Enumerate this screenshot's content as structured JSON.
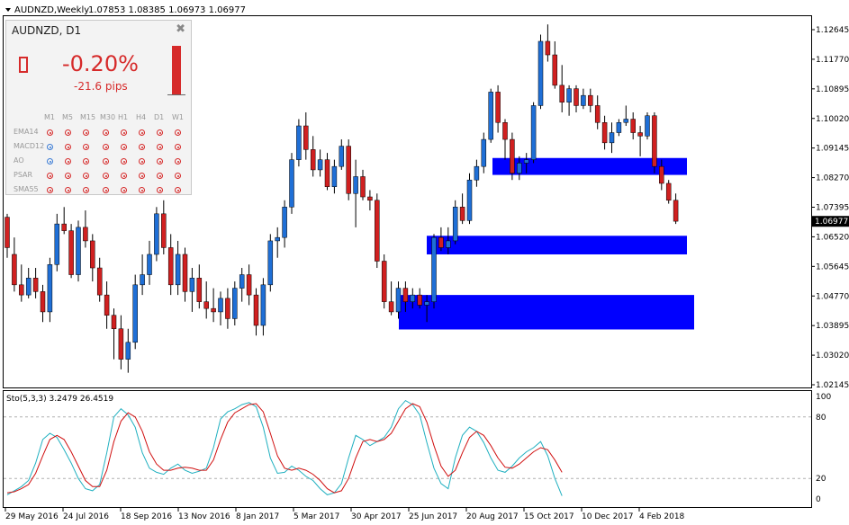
{
  "header": {
    "symbol_tf": "AUDNZD,Weekly",
    "ohlc": "1.07853 1.08385 1.06973 1.06977"
  },
  "panel": {
    "title": "AUDNZD,  D1",
    "change_pct": "-0.20%",
    "change_pips": "-21.6 pips",
    "close_icon": "close-icon",
    "timeframes": [
      "M1",
      "M5",
      "M15",
      "M30",
      "H1",
      "H4",
      "D1",
      "W1"
    ],
    "indicators": [
      {
        "name": "EMA14",
        "signals": [
          "sell",
          "sell",
          "sell",
          "sell",
          "sell",
          "sell",
          "sell",
          "sell"
        ]
      },
      {
        "name": "MACD12",
        "signals": [
          "buy",
          "sell",
          "sell",
          "sell",
          "sell",
          "sell",
          "sell",
          "sell"
        ]
      },
      {
        "name": "AO",
        "signals": [
          "buy",
          "sell",
          "sell",
          "sell",
          "sell",
          "sell",
          "sell",
          "sell"
        ]
      },
      {
        "name": "PSAR",
        "signals": [
          "sell",
          "sell",
          "sell",
          "sell",
          "sell",
          "sell",
          "sell",
          "sell"
        ]
      },
      {
        "name": "SMA55",
        "signals": [
          "sell",
          "sell",
          "sell",
          "sell",
          "sell",
          "sell",
          "sell",
          "sell"
        ]
      }
    ]
  },
  "price_axis": {
    "ticks": [
      "1.12645",
      "1.11770",
      "1.10895",
      "1.10020",
      "1.09145",
      "1.08270",
      "1.07395",
      "1.06520",
      "1.05645",
      "1.04770",
      "1.03895",
      "1.03020",
      "1.02145"
    ],
    "current": "1.06977"
  },
  "oscillator": {
    "label": "Sto(5,3,3) 3.2479 26.4519",
    "levels": [
      "100",
      "80",
      "20",
      "0"
    ]
  },
  "time_axis": [
    "29 May 2016",
    "24 Jul 2016",
    "18 Sep 2016",
    "13 Nov 2016",
    "8 Jan 2017",
    "5 Mar 2017",
    "30 Apr 2017",
    "25 Jun 2017",
    "20 Aug 2017",
    "15 Oct 2017",
    "10 Dec 2017",
    "4 Feb 2018"
  ],
  "colors": {
    "bull": "#1f6fd6",
    "bear": "#d02020",
    "zone": "#0000ff",
    "stoch_main": "#20b0c0",
    "stoch_signal": "#d01010"
  },
  "chart_data": {
    "type": "candlestick",
    "price_range": [
      1.02,
      1.13
    ],
    "zones": [
      {
        "from": 1.0835,
        "to": 1.0885
      },
      {
        "from": 1.06,
        "to": 1.0655
      },
      {
        "from": 1.0378,
        "to": 1.048
      }
    ],
    "candles": [
      [
        1.071,
        1.072,
        1.059,
        1.062
      ],
      [
        1.06,
        1.065,
        1.049,
        1.051
      ],
      [
        1.051,
        1.057,
        1.046,
        1.048
      ],
      [
        1.048,
        1.056,
        1.047,
        1.053
      ],
      [
        1.053,
        1.056,
        1.047,
        1.049
      ],
      [
        1.049,
        1.051,
        1.04,
        1.043
      ],
      [
        1.043,
        1.059,
        1.04,
        1.057
      ],
      [
        1.057,
        1.072,
        1.055,
        1.069
      ],
      [
        1.069,
        1.074,
        1.066,
        1.067
      ],
      [
        1.067,
        1.069,
        1.053,
        1.054
      ],
      [
        1.054,
        1.07,
        1.052,
        1.068
      ],
      [
        1.068,
        1.073,
        1.062,
        1.064
      ],
      [
        1.064,
        1.066,
        1.052,
        1.056
      ],
      [
        1.056,
        1.059,
        1.046,
        1.048
      ],
      [
        1.048,
        1.052,
        1.038,
        1.042
      ],
      [
        1.042,
        1.044,
        1.029,
        1.038
      ],
      [
        1.038,
        1.042,
        1.026,
        1.029
      ],
      [
        1.029,
        1.038,
        1.025,
        1.034
      ],
      [
        1.034,
        1.054,
        1.032,
        1.051
      ],
      [
        1.051,
        1.06,
        1.048,
        1.054
      ],
      [
        1.054,
        1.064,
        1.051,
        1.06
      ],
      [
        1.06,
        1.074,
        1.058,
        1.072
      ],
      [
        1.072,
        1.076,
        1.06,
        1.062
      ],
      [
        1.062,
        1.066,
        1.048,
        1.051
      ],
      [
        1.051,
        1.064,
        1.048,
        1.06
      ],
      [
        1.06,
        1.062,
        1.046,
        1.049
      ],
      [
        1.049,
        1.056,
        1.043,
        1.053
      ],
      [
        1.053,
        1.057,
        1.044,
        1.046
      ],
      [
        1.046,
        1.052,
        1.041,
        1.044
      ],
      [
        1.044,
        1.05,
        1.04,
        1.043
      ],
      [
        1.043,
        1.049,
        1.039,
        1.047
      ],
      [
        1.047,
        1.05,
        1.038,
        1.041
      ],
      [
        1.041,
        1.052,
        1.039,
        1.05
      ],
      [
        1.05,
        1.056,
        1.046,
        1.054
      ],
      [
        1.054,
        1.057,
        1.045,
        1.048
      ],
      [
        1.048,
        1.05,
        1.036,
        1.039
      ],
      [
        1.039,
        1.053,
        1.036,
        1.051
      ],
      [
        1.051,
        1.066,
        1.049,
        1.064
      ],
      [
        1.064,
        1.068,
        1.059,
        1.065
      ],
      [
        1.065,
        1.076,
        1.062,
        1.074
      ],
      [
        1.074,
        1.09,
        1.072,
        1.088
      ],
      [
        1.088,
        1.1,
        1.086,
        1.098
      ],
      [
        1.098,
        1.102,
        1.088,
        1.091
      ],
      [
        1.091,
        1.095,
        1.083,
        1.085
      ],
      [
        1.085,
        1.091,
        1.083,
        1.088
      ],
      [
        1.088,
        1.09,
        1.079,
        1.08
      ],
      [
        1.08,
        1.088,
        1.078,
        1.086
      ],
      [
        1.086,
        1.094,
        1.085,
        1.092
      ],
      [
        1.092,
        1.094,
        1.076,
        1.078
      ],
      [
        1.078,
        1.088,
        1.068,
        1.083
      ],
      [
        1.083,
        1.085,
        1.076,
        1.077
      ],
      [
        1.077,
        1.079,
        1.073,
        1.076
      ],
      [
        1.076,
        1.078,
        1.056,
        1.058
      ],
      [
        1.058,
        1.06,
        1.044,
        1.046
      ],
      [
        1.046,
        1.052,
        1.042,
        1.043
      ],
      [
        1.043,
        1.052,
        1.041,
        1.05
      ],
      [
        1.05,
        1.052,
        1.043,
        1.046
      ],
      [
        1.046,
        1.05,
        1.044,
        1.048
      ],
      [
        1.048,
        1.05,
        1.044,
        1.045
      ],
      [
        1.045,
        1.048,
        1.04,
        1.046
      ],
      [
        1.046,
        1.066,
        1.044,
        1.065
      ],
      [
        1.065,
        1.068,
        1.061,
        1.062
      ],
      [
        1.062,
        1.068,
        1.06,
        1.064
      ],
      [
        1.064,
        1.076,
        1.063,
        1.074
      ],
      [
        1.074,
        1.078,
        1.069,
        1.07
      ],
      [
        1.07,
        1.084,
        1.069,
        1.082
      ],
      [
        1.082,
        1.088,
        1.08,
        1.086
      ],
      [
        1.086,
        1.096,
        1.084,
        1.094
      ],
      [
        1.094,
        1.109,
        1.093,
        1.108
      ],
      [
        1.108,
        1.11,
        1.096,
        1.099
      ],
      [
        1.099,
        1.1,
        1.088,
        1.094
      ],
      [
        1.094,
        1.096,
        1.082,
        1.084
      ],
      [
        1.084,
        1.089,
        1.082,
        1.087
      ],
      [
        1.087,
        1.09,
        1.084,
        1.088
      ],
      [
        1.088,
        1.105,
        1.087,
        1.104
      ],
      [
        1.104,
        1.125,
        1.103,
        1.123
      ],
      [
        1.123,
        1.128,
        1.117,
        1.119
      ],
      [
        1.119,
        1.123,
        1.109,
        1.11
      ],
      [
        1.11,
        1.116,
        1.102,
        1.105
      ],
      [
        1.105,
        1.11,
        1.101,
        1.109
      ],
      [
        1.109,
        1.11,
        1.102,
        1.104
      ],
      [
        1.104,
        1.109,
        1.103,
        1.107
      ],
      [
        1.107,
        1.109,
        1.102,
        1.104
      ],
      [
        1.104,
        1.107,
        1.097,
        1.099
      ],
      [
        1.099,
        1.101,
        1.091,
        1.093
      ],
      [
        1.093,
        1.099,
        1.09,
        1.096
      ],
      [
        1.096,
        1.1,
        1.095,
        1.099
      ],
      [
        1.099,
        1.104,
        1.098,
        1.1
      ],
      [
        1.1,
        1.102,
        1.094,
        1.096
      ],
      [
        1.096,
        1.098,
        1.089,
        1.095
      ],
      [
        1.095,
        1.102,
        1.094,
        1.101
      ],
      [
        1.101,
        1.102,
        1.084,
        1.086
      ],
      [
        1.086,
        1.088,
        1.079,
        1.081
      ],
      [
        1.081,
        1.082,
        1.075,
        1.076
      ],
      [
        1.076,
        1.078,
        1.069,
        1.0698
      ]
    ],
    "stoch_main": [
      4,
      8,
      12,
      18,
      35,
      58,
      64,
      60,
      48,
      35,
      20,
      10,
      8,
      14,
      45,
      80,
      88,
      82,
      70,
      45,
      30,
      26,
      24,
      30,
      34,
      28,
      25,
      27,
      30,
      50,
      78,
      85,
      88,
      92,
      94,
      90,
      70,
      40,
      25,
      26,
      32,
      28,
      22,
      18,
      10,
      4,
      6,
      15,
      40,
      62,
      58,
      52,
      56,
      60,
      70,
      88,
      96,
      92,
      82,
      55,
      30,
      15,
      10,
      40,
      62,
      70,
      66,
      55,
      40,
      28,
      26,
      32,
      40,
      46,
      50,
      56,
      42,
      20,
      3
    ],
    "stoch_signal": [
      6,
      7,
      10,
      14,
      25,
      42,
      58,
      62,
      58,
      46,
      32,
      18,
      12,
      12,
      28,
      56,
      76,
      84,
      80,
      66,
      46,
      34,
      28,
      28,
      30,
      31,
      30,
      28,
      28,
      38,
      58,
      75,
      84,
      88,
      92,
      93,
      85,
      64,
      42,
      30,
      28,
      30,
      28,
      24,
      18,
      10,
      6,
      8,
      20,
      40,
      56,
      58,
      56,
      58,
      64,
      76,
      88,
      93,
      90,
      75,
      52,
      32,
      22,
      28,
      45,
      60,
      66,
      62,
      52,
      40,
      31,
      30,
      34,
      40,
      46,
      50,
      48,
      38,
      26
    ]
  }
}
